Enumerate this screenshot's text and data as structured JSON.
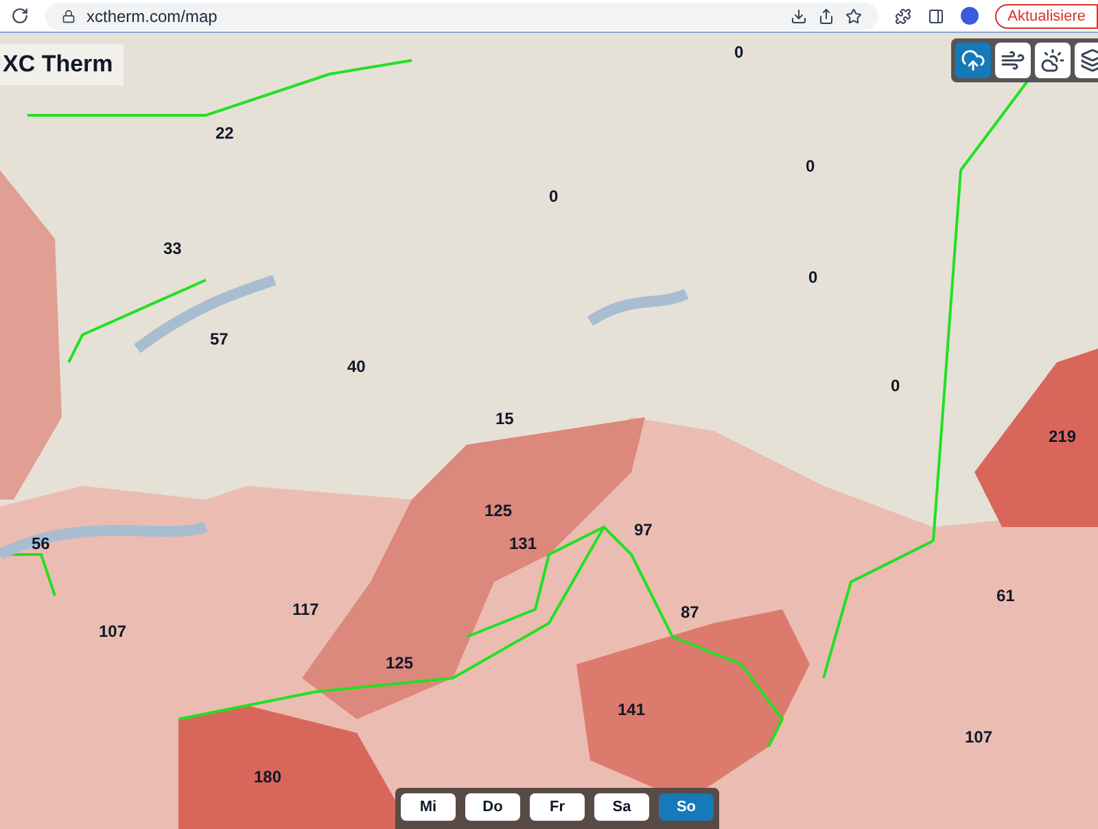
{
  "browser": {
    "url": "xctherm.com/map",
    "update_button": "Aktualisiere"
  },
  "app": {
    "title": "XC Therm"
  },
  "layers": [
    {
      "kind": "thermal",
      "selected": true
    },
    {
      "kind": "wind",
      "selected": false
    },
    {
      "kind": "cloud",
      "selected": false
    },
    {
      "kind": "more",
      "selected": false
    }
  ],
  "regions": [
    {
      "value": "0"
    },
    {
      "value": "22"
    },
    {
      "value": "33"
    },
    {
      "value": "57"
    },
    {
      "value": "40"
    },
    {
      "value": "15"
    },
    {
      "value": "0"
    },
    {
      "value": "0"
    },
    {
      "value": "0"
    },
    {
      "value": "0"
    },
    {
      "value": "219"
    },
    {
      "value": "125"
    },
    {
      "value": "131"
    },
    {
      "value": "97"
    },
    {
      "value": "56"
    },
    {
      "value": "117"
    },
    {
      "value": "107"
    },
    {
      "value": "87"
    },
    {
      "value": "61"
    },
    {
      "value": "125"
    },
    {
      "value": "141"
    },
    {
      "value": "107"
    },
    {
      "value": "180"
    }
  ],
  "days": [
    {
      "label": "Mi",
      "selected": false
    },
    {
      "label": "Do",
      "selected": false
    },
    {
      "label": "Fr",
      "selected": false
    },
    {
      "label": "Sa",
      "selected": false
    },
    {
      "label": "So",
      "selected": true
    }
  ]
}
